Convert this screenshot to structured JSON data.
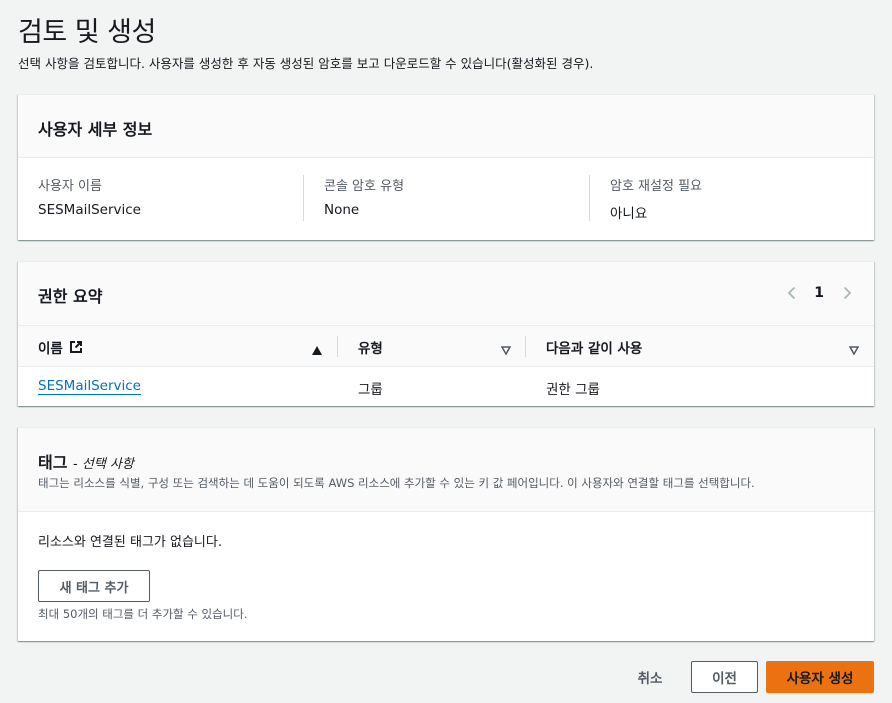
{
  "page": {
    "title": "검토 및 생성",
    "description": "선택 사항을 검토합니다. 사용자를 생성한 후 자동 생성된 암호를 보고 다운로드할 수 있습니다(활성화된 경우)."
  },
  "user_details": {
    "title": "사용자 세부 정보",
    "fields": [
      {
        "label": "사용자 이름",
        "value": "SESMailService"
      },
      {
        "label": "콘솔 암호 유형",
        "value": "None"
      },
      {
        "label": "암호 재설정 필요",
        "value": "아니요"
      }
    ]
  },
  "permissions": {
    "title": "권한 요약",
    "page_number": "1",
    "columns": [
      "이름",
      "유형",
      "다음과 같이 사용"
    ],
    "rows": [
      {
        "name": "SESMailService",
        "type": "그룹",
        "used_as": "권한 그룹"
      }
    ]
  },
  "tags": {
    "title": "태그",
    "title_suffix": "- ",
    "optional": "선택 사항",
    "description": "태그는 리소스를 식별, 구성 또는 검색하는 데 도움이 되도록 AWS 리소스에 추가할 수 있는 키 값 페어입니다. 이 사용자와 연결할 태그를 선택합니다.",
    "empty_message": "리소스와 연결된 태그가 없습니다.",
    "add_button": "새 태그 추가",
    "limit_hint": "최대 50개의 태그를 더 추가할 수 있습니다."
  },
  "footer": {
    "cancel": "취소",
    "previous": "이전",
    "create": "사용자 생성"
  },
  "colors": {
    "primary_button": "#ec7211",
    "link": "#0073bb",
    "background": "#f2f3f3"
  }
}
